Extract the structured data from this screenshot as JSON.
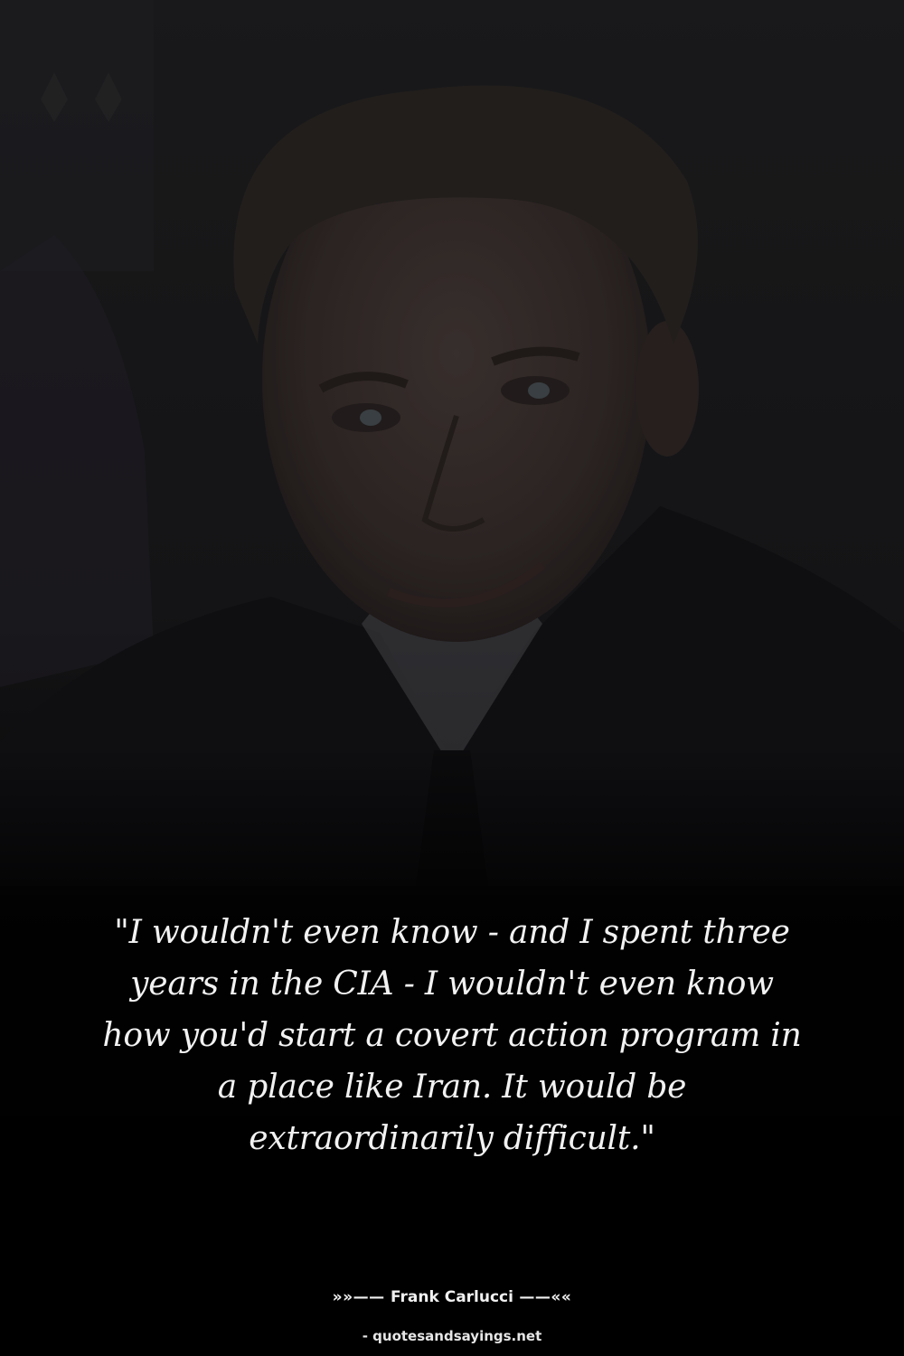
{
  "quote": {
    "text": "\"I wouldn't even know - and I spent three years in the CIA - I wouldn't even know how you'd start a covert action program in a place like Iran. It would be extraordinarily difficult.\""
  },
  "author": {
    "prefix": "»»—— ",
    "name": "Frank Carlucci",
    "suffix": " ——««"
  },
  "source": {
    "text": "- quotesandsayings.net"
  },
  "colors": {
    "background": "#050505",
    "text": "#f2f2f2"
  }
}
